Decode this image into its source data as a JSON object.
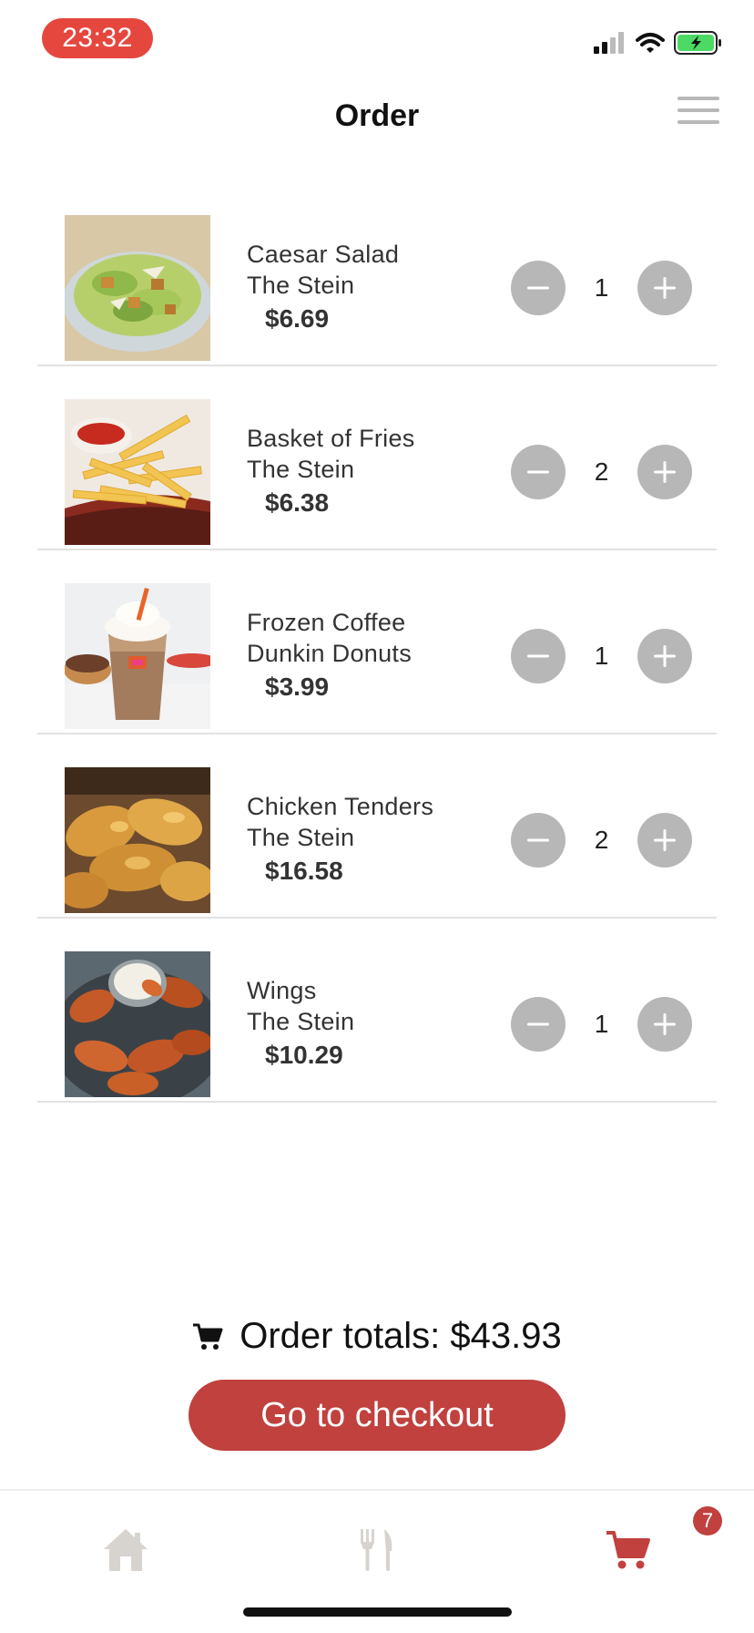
{
  "status_bar": {
    "time": "23:32"
  },
  "header": {
    "title": "Order"
  },
  "items": [
    {
      "name": "Caesar Salad",
      "vendor": "The Stein",
      "price": "$6.69",
      "quantity": "1",
      "image": "caesar-salad"
    },
    {
      "name": "Basket of Fries",
      "vendor": "The Stein",
      "price": "$6.38",
      "quantity": "2",
      "image": "fries"
    },
    {
      "name": "Frozen Coffee",
      "vendor": "Dunkin Donuts",
      "price": "$3.99",
      "quantity": "1",
      "image": "frozen-coffee"
    },
    {
      "name": "Chicken Tenders",
      "vendor": "The Stein",
      "price": "$16.58",
      "quantity": "2",
      "image": "chicken-tenders"
    },
    {
      "name": "Wings",
      "vendor": "The Stein",
      "price": "$10.29",
      "quantity": "1",
      "image": "wings"
    }
  ],
  "totals": {
    "label": "Order totals: $43.93"
  },
  "checkout": {
    "label": "Go to checkout"
  },
  "tab_bar": {
    "cart_badge": "7",
    "active_tab": "cart"
  },
  "icons": {
    "menu": "hamburger-icon",
    "minus": "minus-icon",
    "plus": "plus-icon",
    "cart": "cart-icon",
    "home": "home-icon",
    "fork_knife": "fork-knife-icon"
  },
  "colors": {
    "accent": "#c0413e",
    "time_pill": "#e5473f",
    "stepper": "#b7b7b8",
    "inactive_tab": "#d7d4cf"
  }
}
